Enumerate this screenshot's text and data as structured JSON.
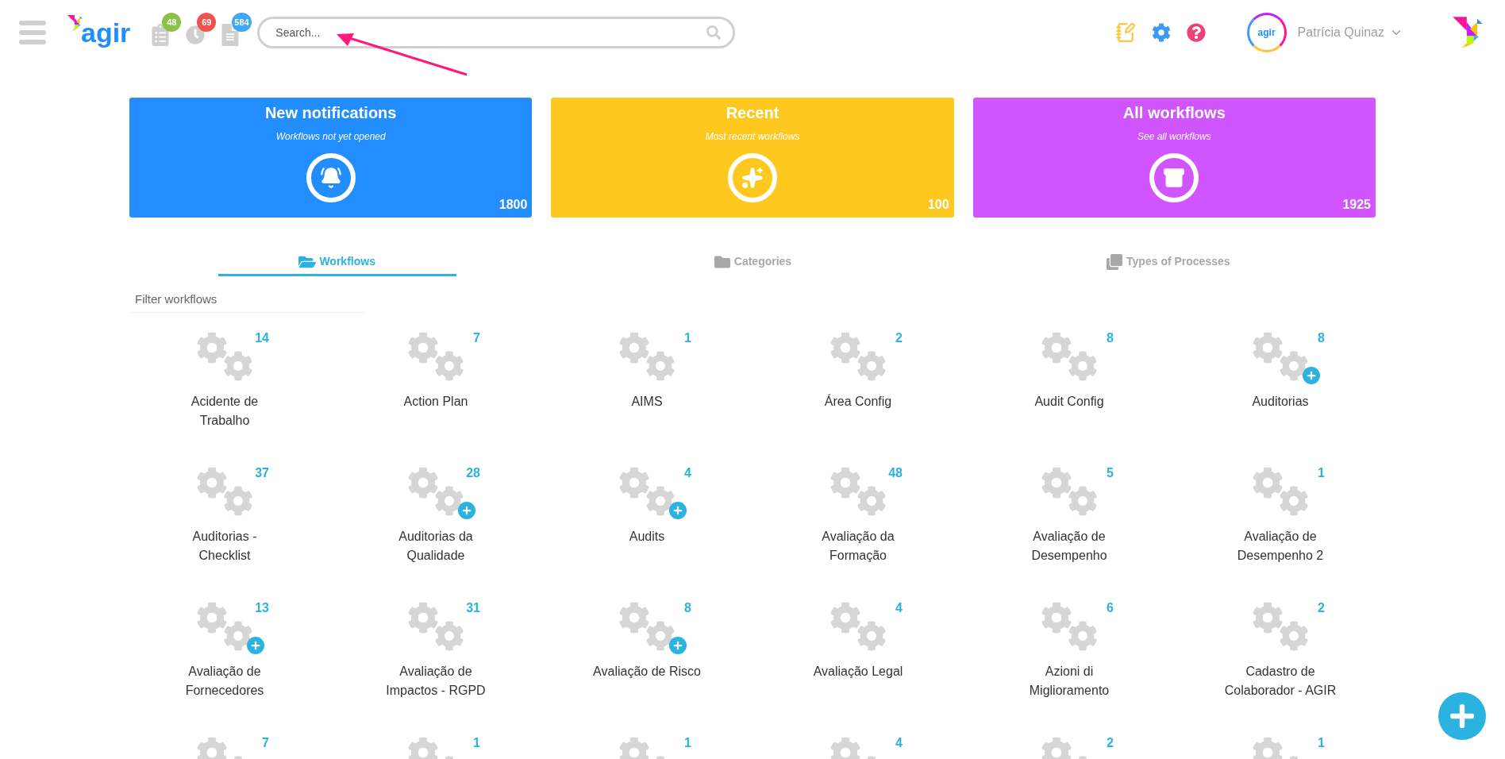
{
  "header": {
    "logo": "agir",
    "counters": [
      {
        "kind": "clipboard",
        "count": "48",
        "color": "#8bc34a"
      },
      {
        "kind": "clock",
        "count": "69",
        "color": "#ef5350"
      },
      {
        "kind": "document",
        "count": "584",
        "color": "#42a5f5"
      }
    ],
    "search": {
      "placeholder": "Search..."
    },
    "user": {
      "avatar_logo": "agir",
      "name": "Patrícia Quinaz"
    }
  },
  "cards": [
    {
      "kind": "bell",
      "title": "New notifications",
      "subtitle": "Workflows not yet opened",
      "count": "1800",
      "color": "#228dff"
    },
    {
      "kind": "sparkles",
      "title": "Recent",
      "subtitle": "Most recent workflows",
      "count": "100",
      "color": "#ffc81e"
    },
    {
      "kind": "archive",
      "title": "All workflows",
      "subtitle": "See all workflows",
      "count": "1925",
      "color": "#d155ff"
    }
  ],
  "tabs": [
    {
      "kind": "workflows",
      "label": "Workflows",
      "selected": true
    },
    {
      "kind": "categories",
      "label": "Categories",
      "selected": false
    },
    {
      "kind": "types",
      "label": "Types of Processes",
      "selected": false
    }
  ],
  "filter": {
    "placeholder": "Filter workflows"
  },
  "workflows": [
    {
      "name": "Acidente de Trabalho",
      "count": "14",
      "add": false
    },
    {
      "name": "Action Plan",
      "count": "7",
      "add": false
    },
    {
      "name": "AIMS",
      "count": "1",
      "add": false
    },
    {
      "name": "Área Config",
      "count": "2",
      "add": false
    },
    {
      "name": "Audit Config",
      "count": "8",
      "add": false
    },
    {
      "name": "Auditorias",
      "count": "8",
      "add": true
    },
    {
      "name": "Auditorias - Checklist",
      "count": "37",
      "add": false
    },
    {
      "name": "Auditorias da Qualidade",
      "count": "28",
      "add": true
    },
    {
      "name": "Audits",
      "count": "4",
      "add": true
    },
    {
      "name": "Avaliação da Formação",
      "count": "48",
      "add": false
    },
    {
      "name": "Avaliação de Desempenho",
      "count": "5",
      "add": false
    },
    {
      "name": "Avaliação de Desempenho 2",
      "count": "1",
      "add": false
    },
    {
      "name": "Avaliação de Fornecedores",
      "count": "13",
      "add": true
    },
    {
      "name": "Avaliação de Impactos - RGPD",
      "count": "31",
      "add": false
    },
    {
      "name": "Avaliação de Risco",
      "count": "8",
      "add": true
    },
    {
      "name": "Avaliação Legal",
      "count": "4",
      "add": false
    },
    {
      "name": "Azioni di Miglioramento",
      "count": "6",
      "add": false
    },
    {
      "name": "Cadastro de Colaborador - AGIR",
      "count": "2",
      "add": false
    },
    {
      "count": "7"
    },
    {
      "count": "1"
    },
    {
      "count": "1"
    },
    {
      "count": "4"
    },
    {
      "count": "2"
    },
    {
      "count": "1"
    }
  ]
}
